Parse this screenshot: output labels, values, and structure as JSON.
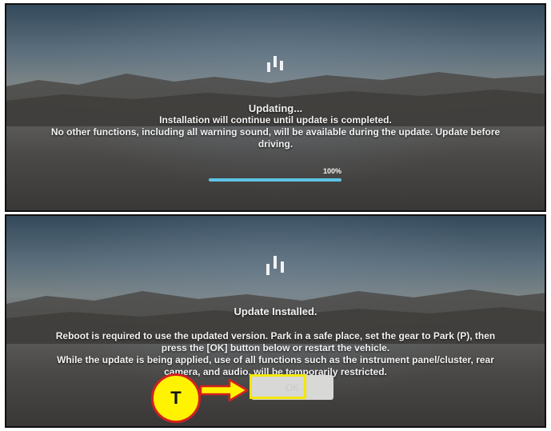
{
  "screens": {
    "updating": {
      "title": "Updating...",
      "line1": "Installation will continue until update is completed.",
      "line2": "No other functions, including all warning sound, will be available during the update. Update before",
      "line3": "driving.",
      "progress": {
        "value_percent": 100,
        "label": "100%"
      }
    },
    "installed": {
      "title": "Update Installed.",
      "line1": "Reboot is required to use the updated version. Park in a safe place, set the gear to Park (P), then",
      "line2": "press the [OK] button below or restart the vehicle.",
      "line3": "While the update is being applied, use of all functions such as the instrument panel/cluster, rear",
      "line4": "camera, and audio, will be temporarily restricted.",
      "ok_label": "OK"
    }
  },
  "callout": {
    "label": "T"
  },
  "colors": {
    "progress_fill": "#5ec3e6",
    "highlight": "#f2e800",
    "callout_fill": "#fff300",
    "callout_border": "#d42020"
  },
  "icons": [
    "brand-bars-icon",
    "arrow-right-icon"
  ]
}
